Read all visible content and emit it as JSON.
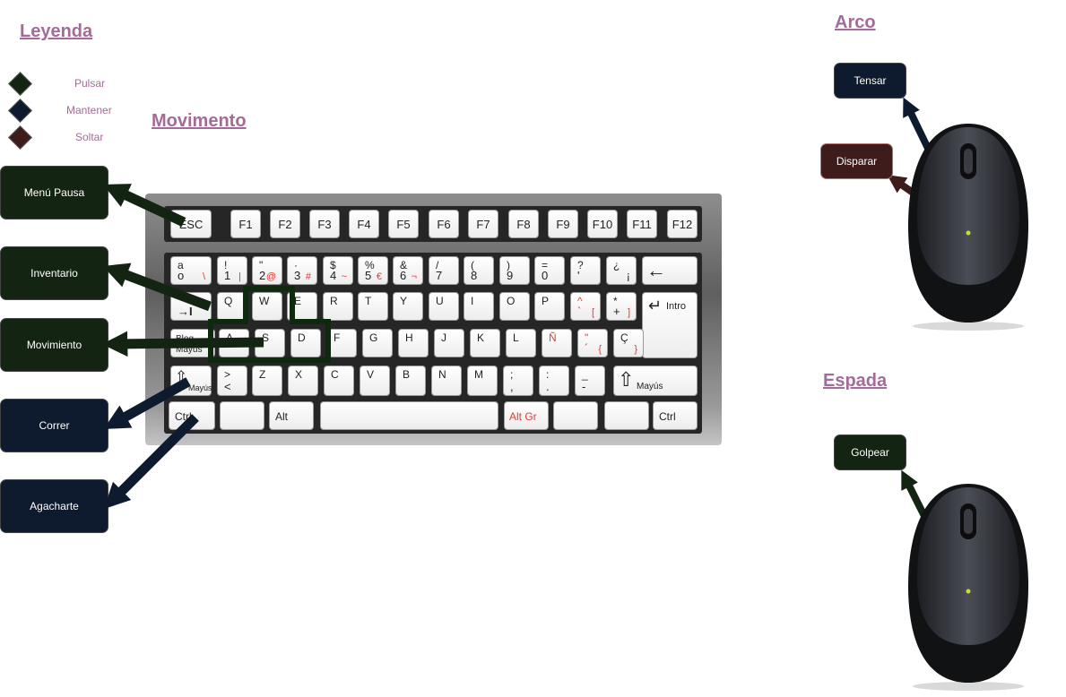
{
  "legend": {
    "title": "Leyenda",
    "items": [
      {
        "label": "Pulsar",
        "color": "#142412"
      },
      {
        "label": "Mantener",
        "color": "#0e1a2e"
      },
      {
        "label": "Soltar",
        "color": "#3f1c1c"
      }
    ]
  },
  "sections": {
    "movimiento": "Movimento",
    "arco": "Arco",
    "espada": "Espada"
  },
  "keyboard_actions": [
    {
      "label": "Menú Pausa",
      "type": "pulsar"
    },
    {
      "label": "Inventario",
      "type": "pulsar"
    },
    {
      "label": "Movimiento",
      "type": "pulsar"
    },
    {
      "label": "Correr",
      "type": "mantener"
    },
    {
      "label": "Agacharte",
      "type": "mantener"
    }
  ],
  "arco_actions": {
    "tensar": {
      "label": "Tensar",
      "type": "mantener"
    },
    "disparar": {
      "label": "Disparar",
      "type": "soltar"
    }
  },
  "espada_actions": {
    "golpear": {
      "label": "Golpear",
      "type": "pulsar"
    }
  },
  "colors": {
    "pulsar": "#142412",
    "mantener": "#0e1a2e",
    "soltar": "#3f1c1c",
    "heading": "#a56b98",
    "highlight": "#0e2a0e"
  },
  "keyboard": {
    "fn_row": [
      "ESC",
      "F1",
      "F2",
      "F3",
      "F4",
      "F5",
      "F6",
      "F7",
      "F8",
      "F9",
      "F10",
      "F11",
      "F12"
    ],
    "number_row": [
      {
        "top": "a",
        "bottom": "o",
        "alt": "\\"
      },
      {
        "top": "!",
        "bottom": "1",
        "alt": "|"
      },
      {
        "top": "\"",
        "bottom": "2",
        "alt": "@"
      },
      {
        "top": "·",
        "bottom": "3",
        "alt": "#"
      },
      {
        "top": "$",
        "bottom": "4",
        "alt": "~"
      },
      {
        "top": "%",
        "bottom": "5",
        "alt": "€"
      },
      {
        "top": "&",
        "bottom": "6",
        "alt": "¬"
      },
      {
        "top": "/",
        "bottom": "7",
        "alt": ""
      },
      {
        "top": "(",
        "bottom": "8",
        "alt": ""
      },
      {
        "top": ")",
        "bottom": "9",
        "alt": ""
      },
      {
        "top": "=",
        "bottom": "0",
        "alt": ""
      },
      {
        "top": "?",
        "bottom": "'",
        "alt": ""
      },
      {
        "top": "¿",
        "bottom": "¡",
        "alt": ""
      }
    ],
    "backspace": "←",
    "tab": "→I",
    "q_row": [
      "Q",
      "W",
      "E",
      "R",
      "T",
      "Y",
      "U",
      "I",
      "O",
      "P"
    ],
    "q_row_extra": [
      {
        "top": "^",
        "bottom": "`",
        "alt": "["
      },
      {
        "top": "*",
        "bottom": "+",
        "alt": "]"
      }
    ],
    "enter": "Intro",
    "enter_symbol": "↵",
    "caps": "Bloq Mayús",
    "a_row": [
      "A",
      "S",
      "D",
      "F",
      "G",
      "H",
      "J",
      "K",
      "L",
      "Ñ"
    ],
    "a_row_extra": [
      {
        "top": "\"",
        "bottom": "´",
        "alt": "{"
      },
      {
        "top": "Ç",
        "bottom": "",
        "alt": "}"
      }
    ],
    "shift_left": "Mayús",
    "z_row_first": {
      "top": ">",
      "bottom": "<"
    },
    "z_row": [
      "Z",
      "X",
      "C",
      "V",
      "B",
      "N",
      "M"
    ],
    "z_row_extra": [
      {
        "top": ";",
        "bottom": ","
      },
      {
        "top": ":",
        "bottom": "."
      },
      {
        "top": "_",
        "bottom": "-"
      }
    ],
    "shift_right": "Mayús",
    "shift_symbol": "⇧",
    "ctrl_left": "Ctrl",
    "alt": "Alt",
    "altgr": "Alt Gr",
    "ctrl_right": "Ctrl"
  }
}
